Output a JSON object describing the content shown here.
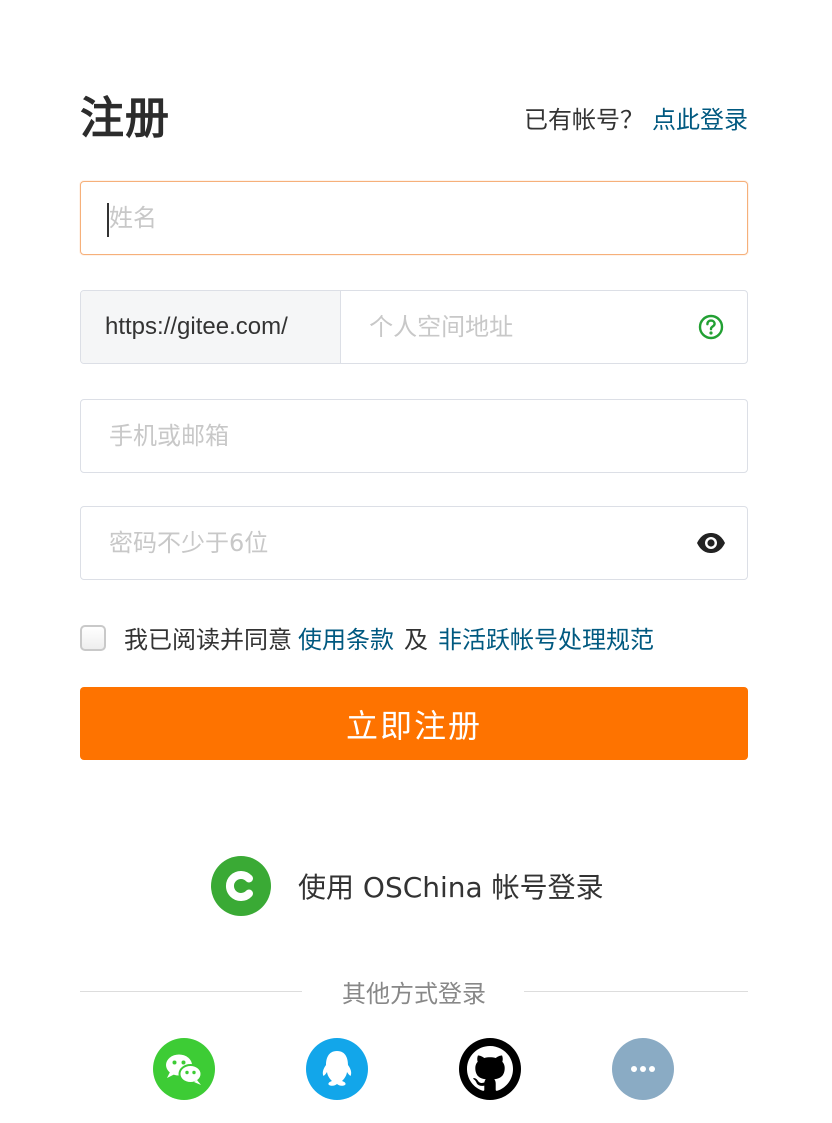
{
  "header": {
    "title": "注册",
    "have_account": "已有帐号？",
    "login_link": "点此登录"
  },
  "form": {
    "name_placeholder": "姓名",
    "url_prefix": "https://gitee.com/",
    "space_placeholder": "个人空间地址",
    "contact_placeholder": "手机或邮箱",
    "password_placeholder": "密码不少于6位"
  },
  "agreement": {
    "prefix": "我已阅读并同意",
    "terms_link": "使用条款",
    "and": "及",
    "policy_link": "非活跃帐号处理规范"
  },
  "submit_label": "立即注册",
  "oschina_login": "使用 OSChina 帐号登录",
  "other_login": {
    "label": "其他方式登录",
    "providers": [
      "wechat-icon",
      "qq-icon",
      "github-icon",
      "more-icon"
    ]
  },
  "colors": {
    "accent": "#fe7300",
    "link": "#005980",
    "wechat": "#3dcc35",
    "qq": "#12a6ea",
    "github": "#000000",
    "more": "#8aabc4",
    "oschina": "#3aaa35"
  }
}
